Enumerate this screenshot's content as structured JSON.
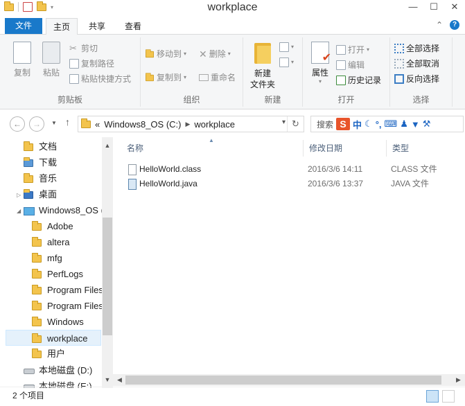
{
  "window": {
    "title": "workplace",
    "minimize": "—",
    "maximize": "☐",
    "close": "✕"
  },
  "ribbon_tabs": {
    "file": "文件",
    "home": "主页",
    "share": "共享",
    "view": "查看",
    "expand": "⌃",
    "help": "?"
  },
  "ribbon": {
    "clipboard": {
      "label": "剪贴板",
      "copy": "复制",
      "paste": "粘贴",
      "cut": "剪切",
      "copy_path": "复制路径",
      "paste_shortcut": "粘贴快捷方式"
    },
    "organize": {
      "label": "组织",
      "move_to": "移动到",
      "copy_to": "复制到",
      "delete": "删除",
      "rename": "重命名"
    },
    "new": {
      "label": "新建",
      "new_folder": "新建\n文件夹"
    },
    "open": {
      "label": "打开",
      "properties": "属性",
      "open": "打开",
      "edit": "编辑",
      "history": "历史记录"
    },
    "select": {
      "label": "选择",
      "select_all": "全部选择",
      "select_none": "全部取消",
      "invert": "反向选择"
    }
  },
  "address": {
    "overflow": "«",
    "crumbs": [
      "Windows8_OS (C:)",
      "workplace"
    ],
    "search_placeholder": "搜索",
    "ime_mode": "中"
  },
  "nav_tree": [
    {
      "label": "文档",
      "kind": "special"
    },
    {
      "label": "下载",
      "kind": "special"
    },
    {
      "label": "音乐",
      "kind": "special"
    },
    {
      "label": "桌面",
      "kind": "special"
    },
    {
      "label": "Windows8_OS (",
      "kind": "drive"
    },
    {
      "label": "Adobe",
      "kind": "folder"
    },
    {
      "label": "altera",
      "kind": "folder"
    },
    {
      "label": "mfg",
      "kind": "folder"
    },
    {
      "label": "PerfLogs",
      "kind": "folder"
    },
    {
      "label": "Program Files",
      "kind": "folder"
    },
    {
      "label": "Program Files",
      "kind": "folder"
    },
    {
      "label": "Windows",
      "kind": "folder"
    },
    {
      "label": "workplace",
      "kind": "folder",
      "selected": true
    },
    {
      "label": "用户",
      "kind": "folder"
    },
    {
      "label": "本地磁盘 (D:)",
      "kind": "disk"
    },
    {
      "label": "本地磁盘 (E:)",
      "kind": "disk"
    }
  ],
  "columns": {
    "name": "名称",
    "modified": "修改日期",
    "type": "类型"
  },
  "files": [
    {
      "name": "HelloWorld.class",
      "modified": "2016/3/6 14:11",
      "type": "CLASS 文件"
    },
    {
      "name": "HelloWorld.java",
      "modified": "2016/3/6 13:37",
      "type": "JAVA 文件"
    }
  ],
  "status": {
    "item_count": "2 个项目"
  }
}
